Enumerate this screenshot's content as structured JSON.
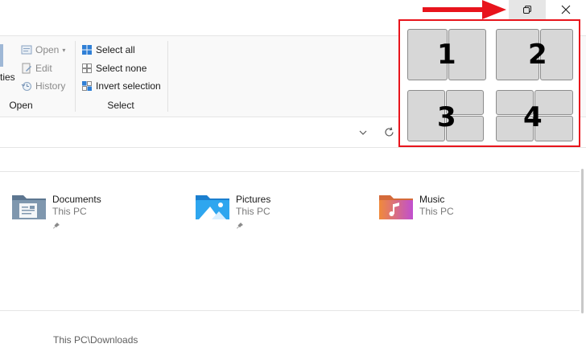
{
  "ribbon": {
    "open_group": {
      "partial_label": "ties",
      "items": [
        {
          "label": "Open",
          "icon": "open-icon",
          "has_dropdown": true
        },
        {
          "label": "Edit",
          "icon": "edit-icon"
        },
        {
          "label": "History",
          "icon": "history-icon"
        }
      ],
      "group_label": "Open"
    },
    "select_group": {
      "items": [
        {
          "label": "Select all",
          "icon": "select-all-icon"
        },
        {
          "label": "Select none",
          "icon": "select-none-icon"
        },
        {
          "label": "Invert selection",
          "icon": "invert-selection-icon"
        }
      ],
      "group_label": "Select"
    }
  },
  "quick_access": [
    {
      "name": "Documents",
      "location": "This PC",
      "icon": "documents-folder-icon"
    },
    {
      "name": "Pictures",
      "location": "This PC",
      "icon": "pictures-folder-icon"
    },
    {
      "name": "Music",
      "location": "This PC",
      "icon": "music-folder-icon"
    }
  ],
  "recent_path": "This PC\\Downloads",
  "snap_layouts": [
    {
      "label": "1"
    },
    {
      "label": "2"
    },
    {
      "label": "3"
    },
    {
      "label": "4"
    }
  ],
  "colors": {
    "accent_red": "#e8141c",
    "zone_fill": "#d7d7d7",
    "ribbon_bg": "#f9f9f9"
  }
}
